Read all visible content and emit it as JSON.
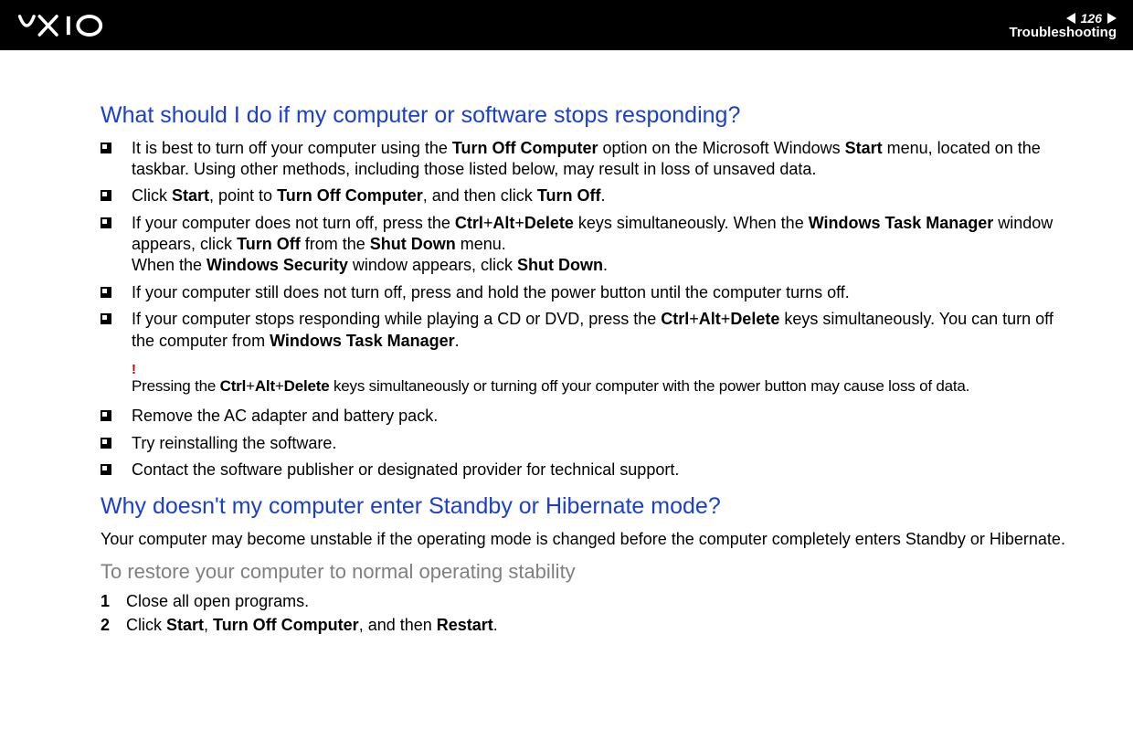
{
  "header": {
    "page_number": "126",
    "section": "Troubleshooting"
  },
  "q1": {
    "title": "What should I do if my computer or software stops responding?",
    "bullets": {
      "b1_pre": "It is best to turn off your computer using the ",
      "b1_k1": "Turn Off Computer",
      "b1_mid": " option on the Microsoft Windows ",
      "b1_k2": "Start",
      "b1_post": " menu, located on the taskbar. Using other methods, including those listed below, may result in loss of unsaved data.",
      "b2_pre": "Click ",
      "b2_k1": "Start",
      "b2_mid1": ", point to ",
      "b2_k2": "Turn Off Computer",
      "b2_mid2": ", and then click ",
      "b2_k3": "Turn Off",
      "b2_post": ".",
      "b3_pre": "If your computer does not turn off, press the ",
      "b3_k1": "Ctrl",
      "b3_plus1": "+",
      "b3_k2": "Alt",
      "b3_plus2": "+",
      "b3_k3": "Delete",
      "b3_mid1": " keys simultaneously. When the ",
      "b3_k4": "Windows Task Manager",
      "b3_mid2": " window appears, click ",
      "b3_k5": "Turn Off",
      "b3_mid3": " from the ",
      "b3_k6": "Shut Down",
      "b3_mid4": " menu.",
      "b3_line2_pre": "When the ",
      "b3_line2_k1": "Windows Security",
      "b3_line2_mid": " window appears, click ",
      "b3_line2_k2": "Shut Down",
      "b3_line2_post": ".",
      "b4": "If your computer still does not turn off, press and hold the power button until the computer turns off.",
      "b5_pre": "If your computer stops responding while playing a CD or DVD, press the ",
      "b5_k1": "Ctrl",
      "b5_plus1": "+",
      "b5_k2": "Alt",
      "b5_plus2": "+",
      "b5_k3": "Delete",
      "b5_mid": " keys simultaneously. You can turn off the computer from ",
      "b5_k4": "Windows Task Manager",
      "b5_post": ".",
      "b6": "Remove the AC adapter and battery pack.",
      "b7": "Try reinstalling the software.",
      "b8": "Contact the software publisher or designated provider for technical support."
    },
    "note": {
      "mark": "!",
      "pre": "Pressing the ",
      "k1": "Ctrl",
      "plus1": "+",
      "k2": "Alt",
      "plus2": "+",
      "k3": "Delete",
      "post": " keys simultaneously or turning off your computer with the power button may cause loss of data."
    }
  },
  "q2": {
    "title": "Why doesn't my computer enter Standby or Hibernate mode?",
    "para": "Your computer may become unstable if the operating mode is changed before the computer completely enters Standby or Hibernate.",
    "subheading": "To restore your computer to normal operating stability",
    "steps": {
      "s1_num": "1",
      "s1_text": "Close all open programs.",
      "s2_num": "2",
      "s2_pre": "Click ",
      "s2_k1": "Start",
      "s2_mid1": ", ",
      "s2_k2": "Turn Off Computer",
      "s2_mid2": ", and then ",
      "s2_k3": "Restart",
      "s2_post": "."
    }
  }
}
